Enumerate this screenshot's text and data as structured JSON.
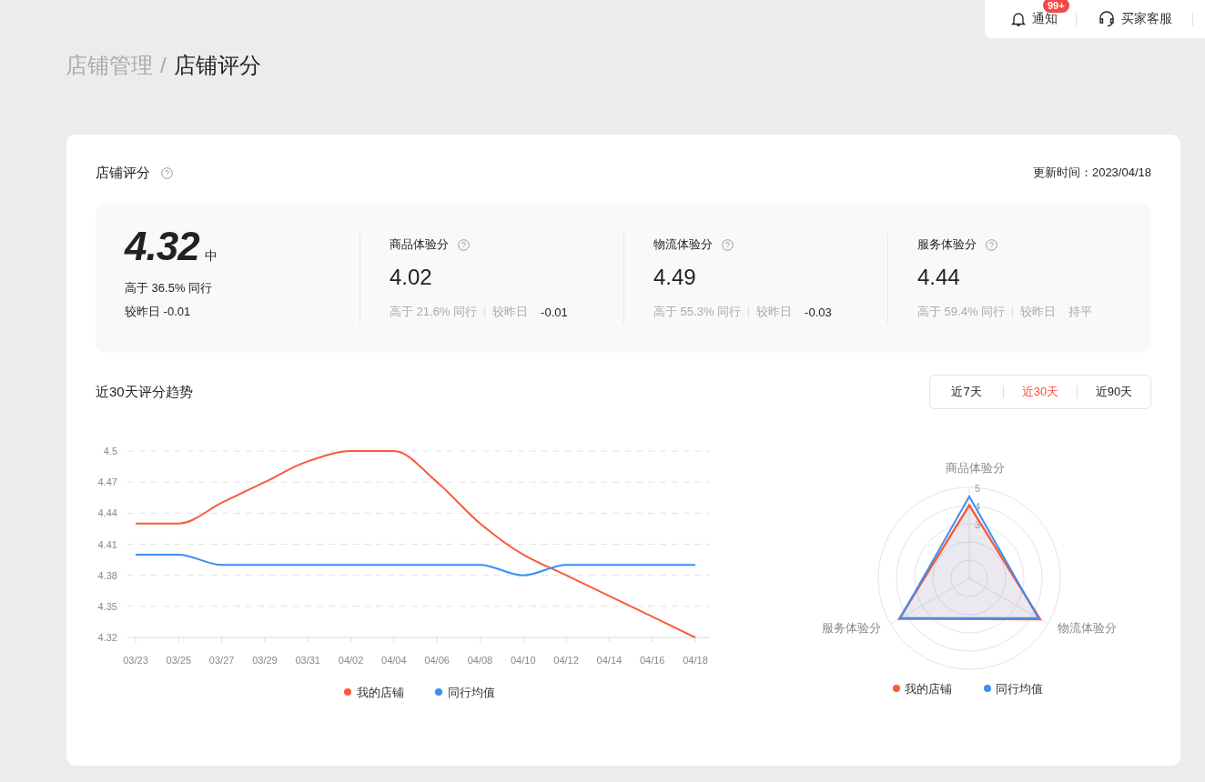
{
  "top_bar": {
    "notification": {
      "label": "通知",
      "badge": "99+"
    },
    "support": {
      "label": "买家客服"
    }
  },
  "breadcrumb": {
    "parent": "店铺管理",
    "separator": "/",
    "current": "店铺评分"
  },
  "score_card": {
    "title": "店铺评分",
    "update_time": "更新时间：2023/04/18",
    "overall": {
      "score": "4.32",
      "grade": "中",
      "beat": "高于 36.5% 同行",
      "change": "较昨日 -0.01"
    },
    "metrics": [
      {
        "name": "商品体验分",
        "score": "4.02",
        "beat": "高于 21.6% 同行",
        "change_label": "较昨日",
        "change": "-0.01",
        "kind": "delta"
      },
      {
        "name": "物流体验分",
        "score": "4.49",
        "beat": "高于 55.3% 同行",
        "change_label": "较昨日",
        "change": "-0.03",
        "kind": "delta"
      },
      {
        "name": "服务体验分",
        "score": "4.44",
        "beat": "高于 59.4% 同行",
        "change_label": "较昨日",
        "change": "持平",
        "kind": "flat"
      }
    ]
  },
  "trend": {
    "title": "近30天评分趋势",
    "ranges": [
      {
        "label": "近7天",
        "selected": false
      },
      {
        "label": "近30天",
        "selected": true
      },
      {
        "label": "近90天",
        "selected": false
      }
    ],
    "chart_data": {
      "type": "line",
      "categories": [
        "03/23",
        "03/25",
        "03/27",
        "03/29",
        "03/31",
        "04/02",
        "04/04",
        "04/06",
        "04/08",
        "04/10",
        "04/12",
        "04/14",
        "04/16",
        "04/18"
      ],
      "series": [
        {
          "name": "我的店铺",
          "color": "#fa5a3c",
          "values": [
            4.43,
            4.43,
            4.45,
            4.47,
            4.49,
            4.5,
            4.5,
            4.47,
            4.43,
            4.4,
            4.38,
            4.36,
            4.34,
            4.32
          ]
        },
        {
          "name": "同行均值",
          "color": "#3a8ef6",
          "values": [
            4.4,
            4.4,
            4.39,
            4.39,
            4.39,
            4.39,
            4.39,
            4.39,
            4.39,
            4.38,
            4.39,
            4.39,
            4.39,
            4.39
          ]
        }
      ],
      "ylim": [
        4.32,
        4.5
      ],
      "yticks": [
        4.32,
        4.35,
        4.38,
        4.41,
        4.44,
        4.47,
        {
          "value": 4.5,
          "label": "4.5"
        }
      ],
      "grid": true,
      "legend": "bottom"
    },
    "radar": {
      "axes": [
        "商品体验分",
        "物流体验分",
        "服务体验分"
      ],
      "ring_labels": [
        "5",
        "4",
        "3"
      ],
      "legend": [
        {
          "label": "我的店铺",
          "color": "#fa5a3c"
        },
        {
          "label": "同行均值",
          "color": "#3a8ef6"
        }
      ]
    }
  }
}
